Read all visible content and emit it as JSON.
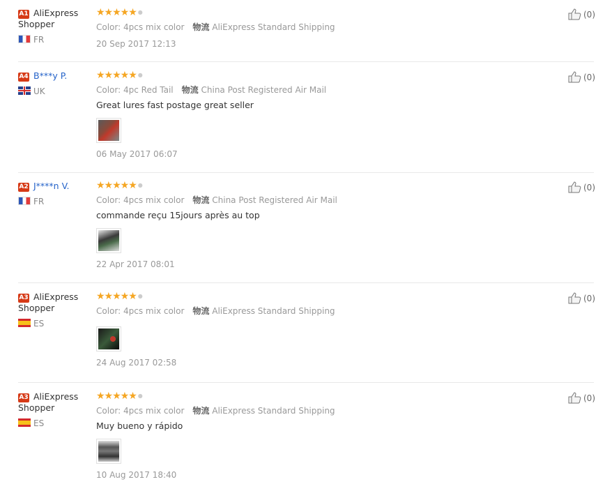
{
  "reviews": [
    {
      "badge": "A1",
      "user": "AliExpress Shopper",
      "country": "FR",
      "flag": "fr",
      "color_label": "Color:",
      "color_value": "4pcs mix color",
      "ship_label": "物流",
      "ship_value": "AliExpress Standard Shipping",
      "text": "",
      "has_photo": false,
      "date": "20 Sep 2017 12:13",
      "likes": "(0)"
    },
    {
      "badge": "A4",
      "user": "B***y P.",
      "country": "UK",
      "flag": "uk",
      "color_label": "Color:",
      "color_value": "4pc Red Tail",
      "ship_label": "物流",
      "ship_value": "China Post Registered Air Mail",
      "text": "Great lures fast postage great seller",
      "has_photo": true,
      "date": "06 May 2017 06:07",
      "likes": "(0)"
    },
    {
      "badge": "A2",
      "user": "J****n V.",
      "country": "FR",
      "flag": "fr",
      "color_label": "Color:",
      "color_value": "4pcs mix color",
      "ship_label": "物流",
      "ship_value": "China Post Registered Air Mail",
      "text": "commande reçu 15jours après au top",
      "has_photo": true,
      "date": "22 Apr 2017 08:01",
      "likes": "(0)"
    },
    {
      "badge": "A3",
      "user": "AliExpress Shopper",
      "country": "ES",
      "flag": "es",
      "color_label": "Color:",
      "color_value": "4pcs mix color",
      "ship_label": "物流",
      "ship_value": "AliExpress Standard Shipping",
      "text": "",
      "has_photo": true,
      "date": "24 Aug 2017 02:58",
      "likes": "(0)"
    },
    {
      "badge": "A3",
      "user": "AliExpress Shopper",
      "country": "ES",
      "flag": "es",
      "color_label": "Color:",
      "color_value": "4pcs mix color",
      "ship_label": "物流",
      "ship_value": "AliExpress Standard Shipping",
      "text": "Muy bueno y rápido",
      "has_photo": true,
      "date": "10 Aug 2017 18:40",
      "likes": "(0)"
    }
  ],
  "colors": {
    "star": "#f5a623",
    "badge": "#d63a17",
    "link": "#2563c9"
  }
}
